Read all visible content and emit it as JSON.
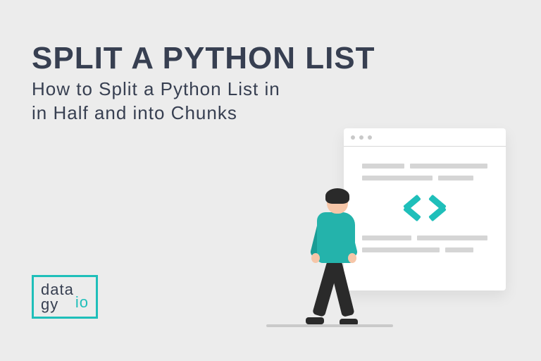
{
  "title": "SPLIT A PYTHON LIST",
  "subtitle": "How to Split a Python List in\nin Half and into Chunks",
  "logo": {
    "line1": "data",
    "line2": "gy",
    "suffix": "io"
  },
  "colors": {
    "accent": "#1fbfba",
    "text": "#373f51",
    "background": "#ececec"
  },
  "illustration": {
    "person": "person-walking",
    "window_icon": "code-brackets"
  }
}
